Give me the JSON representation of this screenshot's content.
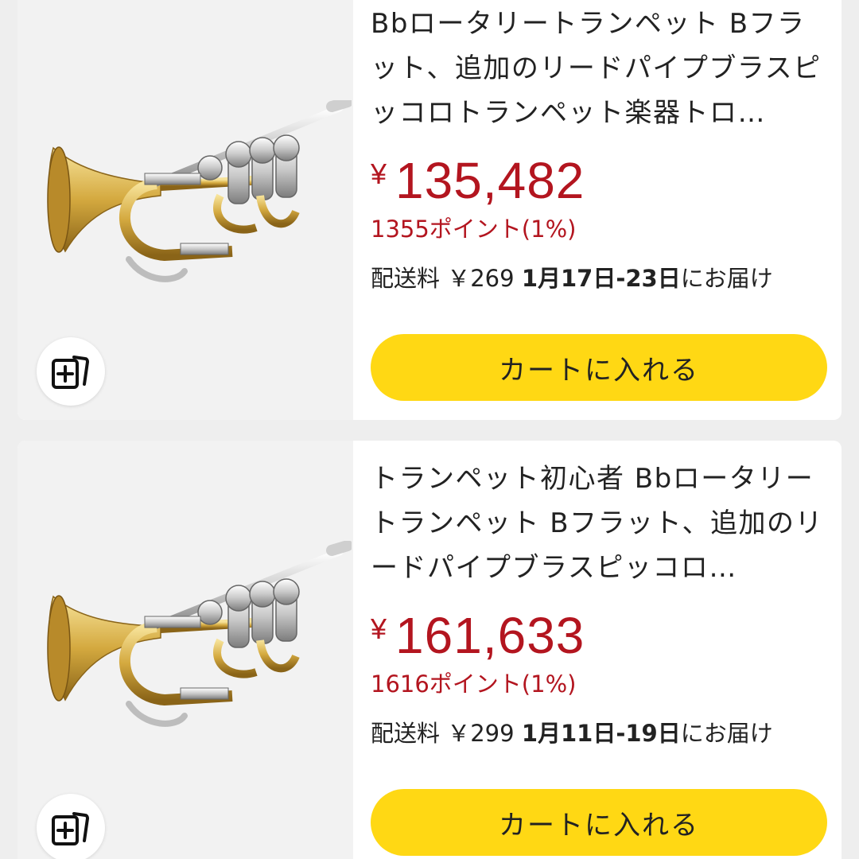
{
  "products": [
    {
      "title": "Bbロータリートランペット Bフラット、追加のリードパイプブラスピッコロトランペット楽器トロ…",
      "price_symbol": "¥",
      "price": "135,482",
      "points": "1355ポイント(1%)",
      "shipping_label": "配送料",
      "shipping_fee": "￥269",
      "delivery_date": "1月17日-23日",
      "delivery_suffix": "にお届け",
      "cart_label": "カートに入れる",
      "favorite_icon": "add-to-list-icon"
    },
    {
      "title": "トランペット初心者 Bbロータリートランペット Bフラット、追加のリードパイプブラスピッコロ…",
      "price_symbol": "¥",
      "price": "161,633",
      "points": "1616ポイント(1%)",
      "shipping_label": "配送料",
      "shipping_fee": "￥299",
      "delivery_date": "1月11日-19日",
      "delivery_suffix": "にお届け",
      "cart_label": "カートに入れる",
      "favorite_icon": "add-to-list-icon"
    }
  ],
  "colors": {
    "price": "#b3151f",
    "cart_button": "#ffd814",
    "background": "#eeeeee"
  }
}
